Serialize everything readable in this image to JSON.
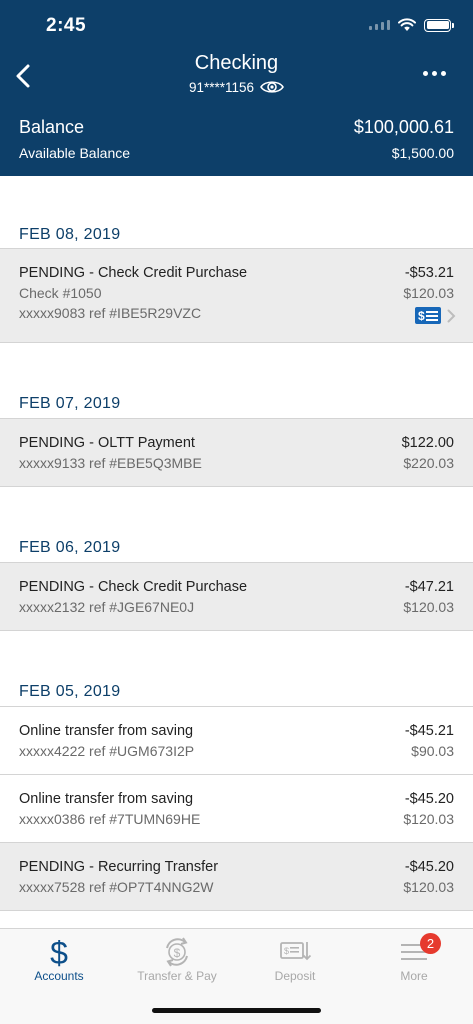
{
  "status_bar": {
    "time": "2:45"
  },
  "header": {
    "title": "Checking",
    "account_masked": "91****1156",
    "balance_label": "Balance",
    "balance_value": "$100,000.61",
    "available_label": "Available Balance",
    "available_value": "$1,500.00"
  },
  "sections": [
    {
      "date": "FEB 08, 2019",
      "transactions": [
        {
          "description": "PENDING - Check Credit Purchase",
          "line2": "Check #1050",
          "line3": "xxxxx9083 ref #IBE5R29VZC",
          "amount": "-$53.21",
          "balance": "$120.03",
          "pending": true,
          "has_check_image": true
        }
      ]
    },
    {
      "date": "FEB 07, 2019",
      "transactions": [
        {
          "description": "PENDING - OLTT Payment",
          "line2": "xxxxx9133 ref #EBE5Q3MBE",
          "amount": "$122.00",
          "balance": "$220.03",
          "pending": true
        }
      ]
    },
    {
      "date": "FEB 06, 2019",
      "transactions": [
        {
          "description": "PENDING - Check Credit Purchase",
          "line2": "xxxxx2132 ref #JGE67NE0J",
          "amount": "-$47.21",
          "balance": "$120.03",
          "pending": true
        }
      ]
    },
    {
      "date": "FEB 05, 2019",
      "transactions": [
        {
          "description": "Online transfer from saving",
          "line2": "xxxxx4222 ref #UGM673I2P",
          "amount": "-$45.21",
          "balance": "$90.03",
          "pending": false
        },
        {
          "description": "Online transfer from saving",
          "line2": "xxxxx0386 ref #7TUMN69HE",
          "amount": "-$45.20",
          "balance": "$120.03",
          "pending": false
        },
        {
          "description": "PENDING - Recurring Transfer",
          "line2": "xxxxx7528 ref #OP7T4NNG2W",
          "amount": "-$45.20",
          "balance": "$120.03",
          "pending": true
        }
      ]
    }
  ],
  "tabbar": {
    "items": [
      {
        "label": "Accounts",
        "icon": "dollar-icon",
        "active": true
      },
      {
        "label": "Transfer & Pay",
        "icon": "transfer-icon",
        "active": false
      },
      {
        "label": "Deposit",
        "icon": "deposit-check-icon",
        "active": false
      },
      {
        "label": "More",
        "icon": "menu-icon",
        "active": false,
        "badge": "2"
      }
    ]
  },
  "colors": {
    "header": "#0d3f69",
    "date_text": "#0d3f69",
    "pending_row": "#ececec",
    "badge": "#e63a2e",
    "active_tab": "#0d4f8a"
  }
}
